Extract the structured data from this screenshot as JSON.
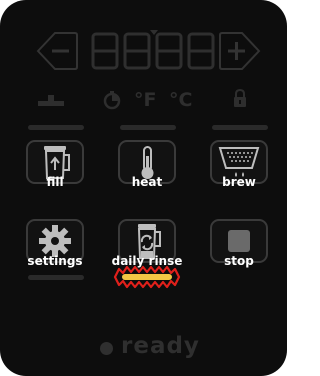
{
  "display": {
    "digits": "8888",
    "temp_f": "°F",
    "temp_c": "°C"
  },
  "buttons": [
    {
      "label": "fill"
    },
    {
      "label": "heat"
    },
    {
      "label": "brew"
    },
    {
      "label": "settings"
    },
    {
      "label": "daily rinse"
    },
    {
      "label": "stop"
    }
  ],
  "status": {
    "text": "ready"
  },
  "colors": {
    "panel": "#0d0d0d",
    "dim": "#2c2c2c",
    "label": "#ffffff",
    "highlight_bar": "#f2c744",
    "highlight_outline": "#e0201b"
  }
}
